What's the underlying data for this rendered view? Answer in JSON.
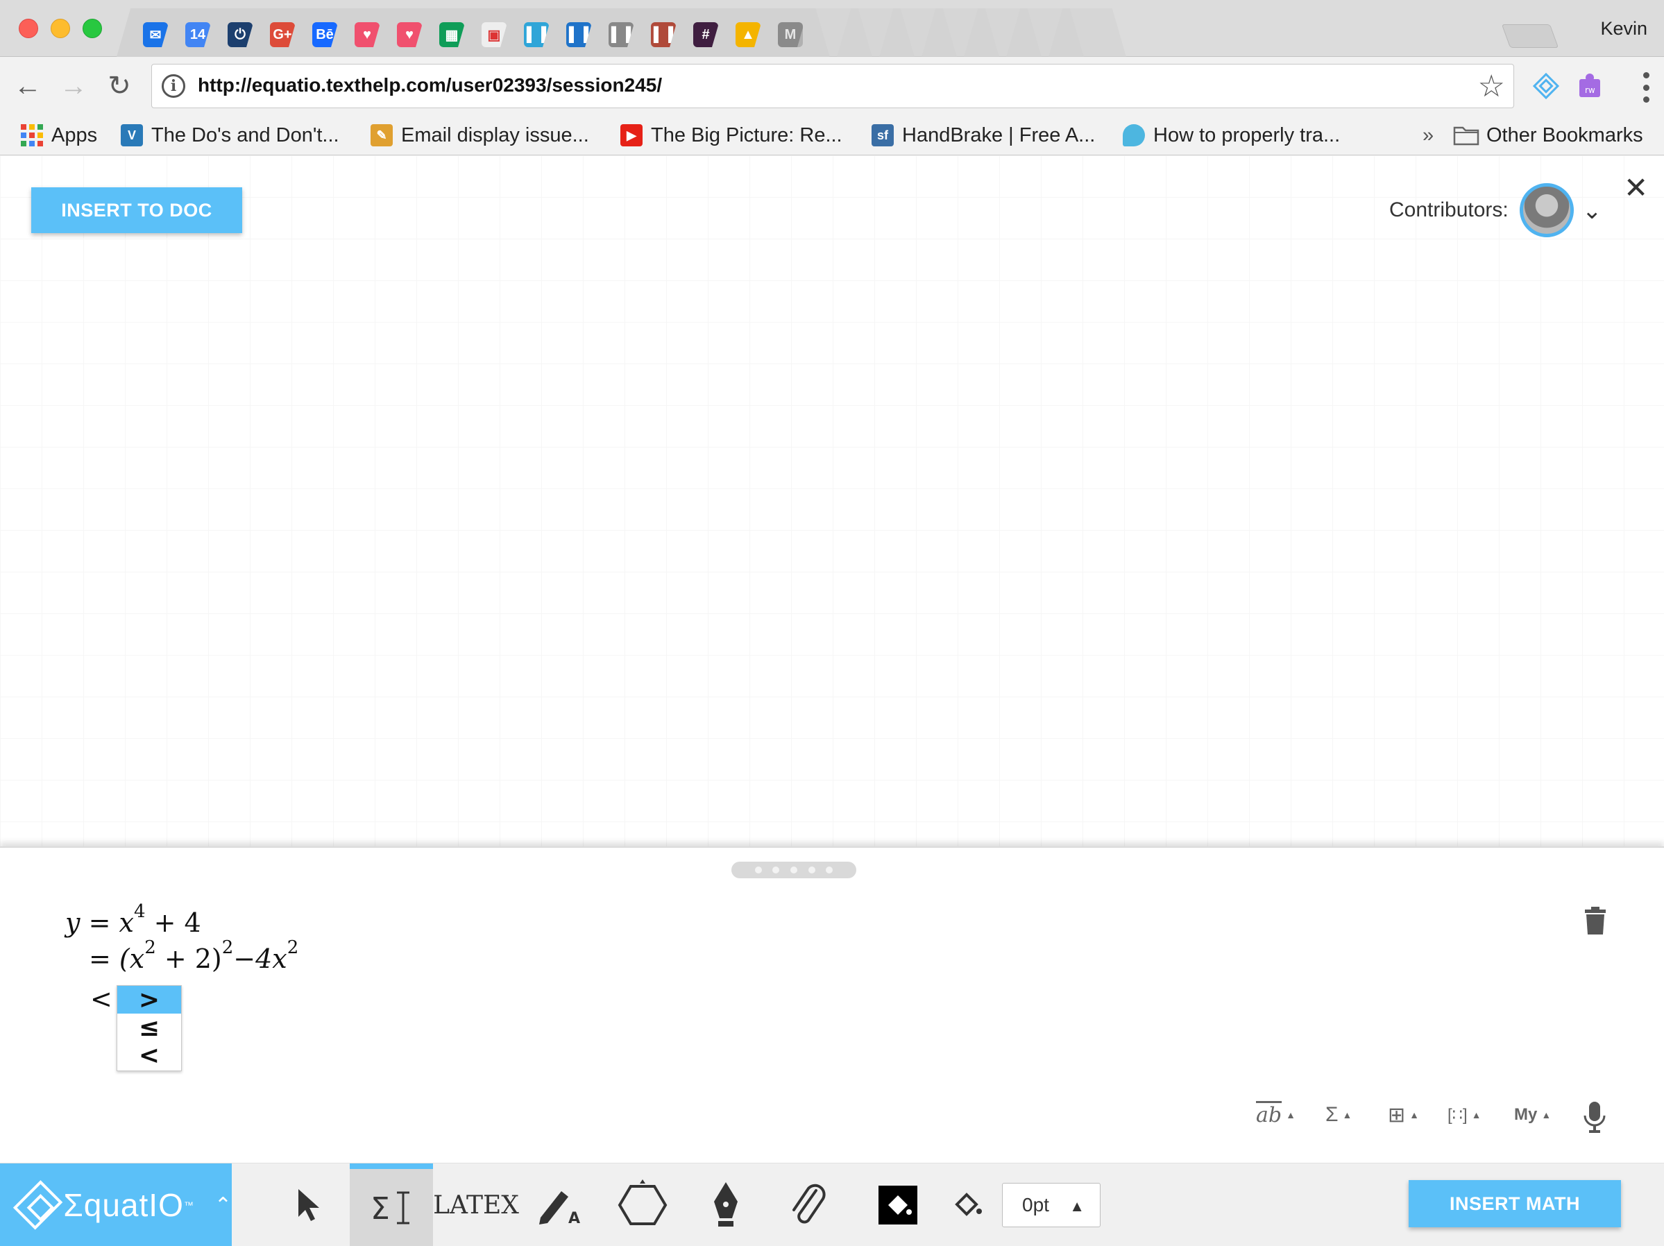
{
  "browser": {
    "profile_name": "Kevin",
    "url": "http://equatio.texthelp.com/user02393/session245/",
    "tabs": [
      {
        "icon": "mail-icon",
        "color": "#1a73e8",
        "glyph": "✉"
      },
      {
        "icon": "calendar-icon",
        "color": "#4285f4",
        "glyph": "14"
      },
      {
        "icon": "power-icon",
        "color": "#1c3f6e",
        "glyph": "⏻"
      },
      {
        "icon": "google-plus-icon",
        "color": "#dd4b39",
        "glyph": "G+"
      },
      {
        "icon": "behance-icon",
        "color": "#1769ff",
        "glyph": "Bē"
      },
      {
        "icon": "bird-icon",
        "color": "#f0506e",
        "glyph": "♥"
      },
      {
        "icon": "bird-icon",
        "color": "#f0506e",
        "glyph": "♥"
      },
      {
        "icon": "sheets-icon",
        "color": "#0f9d58",
        "glyph": "▦"
      },
      {
        "icon": "note-icon",
        "color": "#eeeeee",
        "glyph": "▣"
      },
      {
        "icon": "trello-icon",
        "color": "#2fa5d8",
        "glyph": "▌▐"
      },
      {
        "icon": "trello-icon",
        "color": "#1f73c9",
        "glyph": "▌▐"
      },
      {
        "icon": "trello-icon",
        "color": "#888888",
        "glyph": "▌▐"
      },
      {
        "icon": "trello-icon",
        "color": "#b04a3a",
        "glyph": "▌▐"
      },
      {
        "icon": "slack-icon",
        "color": "#3f1e40",
        "glyph": "#"
      },
      {
        "icon": "drive-icon",
        "color": "#f4b400",
        "glyph": "▲"
      },
      {
        "icon": "m-logo-icon",
        "color": "#333333",
        "glyph": "M"
      }
    ]
  },
  "bookmarks": [
    {
      "label": "Apps",
      "icon": "apps-grid-icon"
    },
    {
      "label": "The Do's and Don't...",
      "icon": "v-logo-icon",
      "color": "#2a7ab8"
    },
    {
      "label": "Email display issue...",
      "icon": "email-bookmark-icon",
      "color": "#e0a030"
    },
    {
      "label": "The Big Picture: Re...",
      "icon": "youtube-icon",
      "color": "#e62117"
    },
    {
      "label": "HandBrake | Free A...",
      "icon": "sf-icon",
      "color": "#3a6ea5"
    },
    {
      "label": "How to properly tra...",
      "icon": "drop-icon",
      "color": "#4db6e0"
    }
  ],
  "bookmarks_more": "»",
  "other_bookmarks": "Other Bookmarks",
  "canvas": {
    "insert_to_doc": "INSERT TO DOC",
    "contributors_label": "Contributors:"
  },
  "editor": {
    "line1": {
      "lhs": "y",
      "eq": "=",
      "x": "x",
      "exp": "4",
      "rest": " + 4"
    },
    "line2": {
      "eq": "= ",
      "open": "(x",
      "exp1": "2",
      "mid": " + 2)",
      "exp2": "2",
      "minus": "−4x",
      "exp3": "2"
    },
    "line3_prefix": "<",
    "dropdown_options": [
      ">",
      "≤",
      "<"
    ],
    "dropdown_selected": 0,
    "toolbar": [
      {
        "name": "text-format-button",
        "label": "ab"
      },
      {
        "name": "sigma-button",
        "label": "Σ"
      },
      {
        "name": "symbols-button",
        "label": "⊞"
      },
      {
        "name": "matrix-button",
        "label": "[∷]"
      },
      {
        "name": "my-button",
        "label": "My"
      }
    ]
  },
  "bottom": {
    "brand": "ΣquatIO",
    "tm": "™",
    "stroke_value": "0pt",
    "insert_math": "INSERT MATH",
    "latex_label": "LATEX"
  },
  "colors": {
    "accent": "#5bc0f8"
  }
}
